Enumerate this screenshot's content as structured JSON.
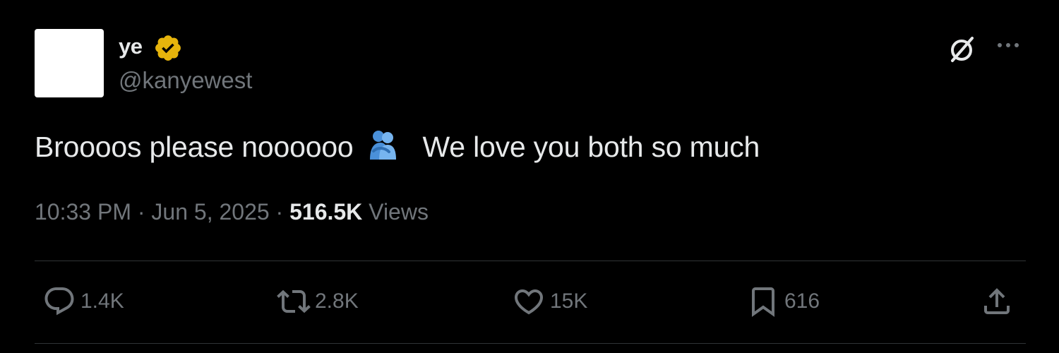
{
  "author": {
    "display_name": "ye",
    "handle": "@kanyewest",
    "verified": true,
    "verified_color": "#e6b40c"
  },
  "tweet": {
    "text_before_emoji": "Brooоos please noooooo",
    "emoji": "people-hugging",
    "text_after_emoji": "We love you both so much"
  },
  "meta": {
    "time": "10:33 PM",
    "separator": "·",
    "date": "Jun 5, 2025",
    "views_count": "516.5K",
    "views_label": "Views"
  },
  "actions": {
    "replies": "1.4K",
    "reposts": "2.8K",
    "likes": "15K",
    "bookmarks": "616"
  },
  "icons": {
    "top_right": [
      "grok-icon",
      "more-icon"
    ],
    "actions": [
      "reply-icon",
      "repost-icon",
      "like-icon",
      "bookmark-icon",
      "share-icon"
    ]
  }
}
